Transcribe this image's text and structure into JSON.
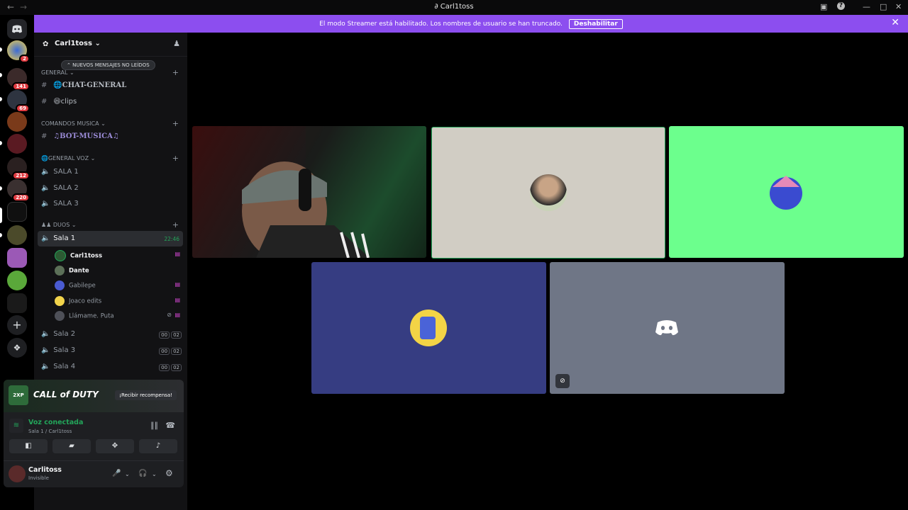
{
  "window": {
    "title": "Carl1toss",
    "logo_glyph": "∂"
  },
  "streamer_banner": {
    "message": "El modo Streamer está habilitado. Los nombres de usuario se han truncado.",
    "button": "Deshabilitar"
  },
  "guild_badges": {
    "g1": "2",
    "g3": "141",
    "g4": "69",
    "g6": "212",
    "g7": "220"
  },
  "server": {
    "name": "Carl1toss"
  },
  "unread_pill": "NUEVOS MENSAJES NO LEÍDOS",
  "categories": {
    "general": "GENERAL",
    "comandos": "COMANDOS MUSICA",
    "voz": "GENERAL VOZ",
    "duos": "DUOS"
  },
  "channels": {
    "chat_general": "CHAT-GENERAL",
    "clips": "clips",
    "bot_musica": "BOT-MUSICA",
    "voz_sala1": "SALA 1",
    "voz_sala2": "SALA 2",
    "voz_sala3": "SALA 3",
    "duo_sala1": "Sala 1",
    "duo_sala1_time": "22:46",
    "duo_sala2": "Sala 2",
    "duo_sala3": "Sala 3",
    "duo_sala4": "Sala 4",
    "count_a": "00",
    "count_b": "02"
  },
  "voice_users": [
    "Carl1toss",
    "Dante",
    "Gabilepe",
    "Joaco edits",
    "Llámame. Puta"
  ],
  "promo": {
    "logo": "CALL of DUTY",
    "button": "¡Recibir recompensa!",
    "tag": "2XP"
  },
  "voice_connection": {
    "status": "Voz conectada",
    "location": "Sala 1 / Carl1toss"
  },
  "user": {
    "name": "Carlitoss",
    "status": "Invisible"
  },
  "colors": {
    "streamer": "#8c4eef",
    "connected": "#23a55a",
    "sidebar": "#121214"
  }
}
